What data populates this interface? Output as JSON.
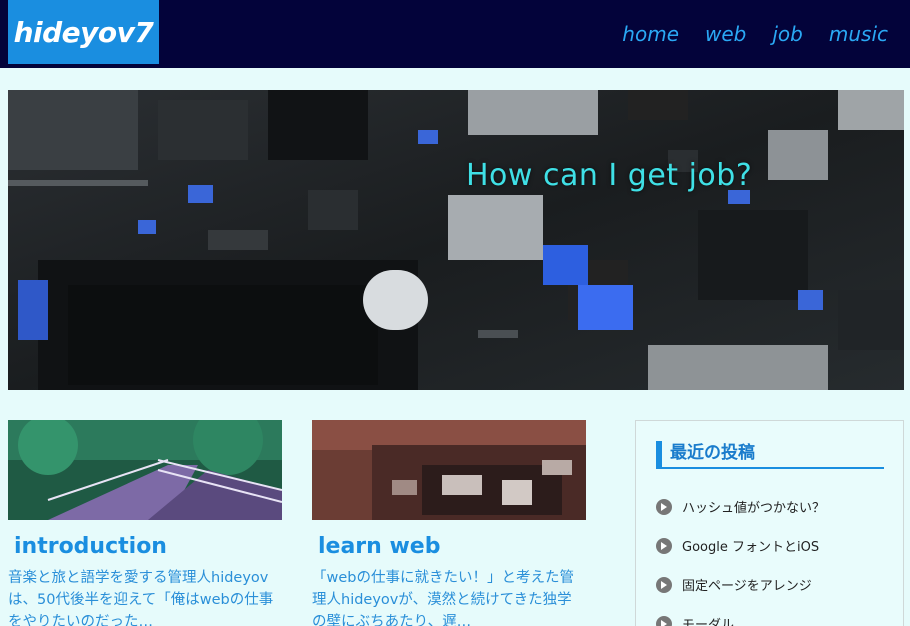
{
  "header": {
    "logo": "hideyov7",
    "nav": [
      "home",
      "web",
      "job",
      "music"
    ]
  },
  "hero": {
    "title": "How can I get job?"
  },
  "cards": [
    {
      "title": "introduction",
      "excerpt": "音楽と旅と語学を愛する管理人hideyovは、50代後半を迎えて「俺はwebの仕事をやりたいのだった…"
    },
    {
      "title": "learn web",
      "excerpt": "「webの仕事に就きたい！」と考えた管理人hideyovが、漠然と続けてきた独学の壁にぶちあたり、遅…"
    }
  ],
  "sidebar": {
    "heading": "最近の投稿",
    "posts": [
      "ハッシュ値がつかない？",
      "Google フォントとiOS",
      "固定ページをアレンジ",
      "モーダル"
    ]
  },
  "colors": {
    "header_bg": "#03033a",
    "logo_bg": "#1a8ee0",
    "nav_link": "#2aa8f4",
    "page_bg": "#e6fbfb",
    "accent": "#1a8ee0",
    "hero_title": "#3fe0e6"
  },
  "icons": {
    "post_bullet": "chevron-circle-right-icon"
  }
}
